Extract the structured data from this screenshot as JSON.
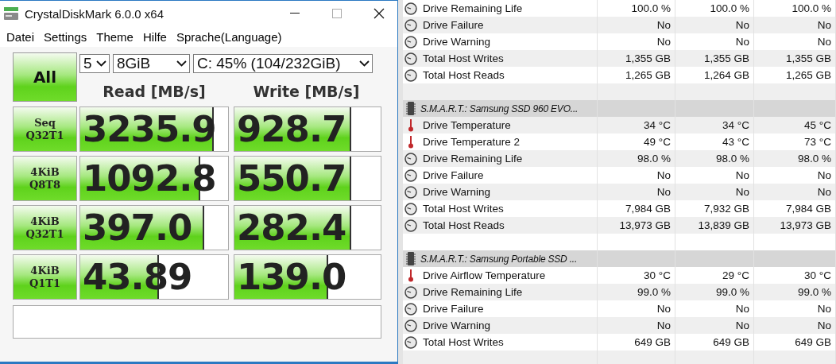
{
  "benchmark_window": {
    "title": "CrystalDiskMark 6.0.0 x64",
    "menu": [
      "Datei",
      "Settings",
      "Theme",
      "Hilfe",
      "Sprache(Language)"
    ],
    "all_button": "All",
    "count": "5",
    "size": "8GiB",
    "drive": "C: 45% (104/232GiB)",
    "read_header": "Read [MB/s]",
    "write_header": "Write [MB/s]",
    "tests": [
      {
        "label": "Seq",
        "sub": "Q32T1",
        "read": {
          "value": "3235.9",
          "level": 0.89
        },
        "write": {
          "value": "928.7",
          "level": 0.79
        }
      },
      {
        "label": "4KiB",
        "sub": "Q8T8",
        "read": {
          "value": "1092.8",
          "level": 0.8
        },
        "write": {
          "value": "550.7",
          "level": 0.79
        }
      },
      {
        "label": "4KiB",
        "sub": "Q32T1",
        "read": {
          "value": "397.0",
          "level": 0.83
        },
        "write": {
          "value": "282.4",
          "level": 0.79
        }
      },
      {
        "label": "4KiB",
        "sub": "Q1T1",
        "read": {
          "value": "43.89",
          "level": 0.52
        },
        "write": {
          "value": "139.0",
          "level": 0.63
        }
      }
    ]
  },
  "sensors": {
    "rows": [
      {
        "kind": "gauge",
        "label": "Drive Remaining Life",
        "values": [
          "100.0 %",
          "100.0 %",
          "100.0 %"
        ]
      },
      {
        "kind": "gauge",
        "label": "Drive Failure",
        "values": [
          "No",
          "No",
          "No"
        ]
      },
      {
        "kind": "gauge",
        "label": "Drive Warning",
        "values": [
          "No",
          "No",
          "No"
        ]
      },
      {
        "kind": "gauge",
        "label": "Total Host Writes",
        "values": [
          "1,355 GB",
          "1,355 GB",
          "1,355 GB"
        ]
      },
      {
        "kind": "gauge",
        "label": "Total Host Reads",
        "values": [
          "1,265 GB",
          "1,264 GB",
          "1,265 GB"
        ]
      },
      {
        "kind": "blank"
      },
      {
        "kind": "header",
        "label": "S.M.A.R.T.: Samsung SSD 960 EVO..."
      },
      {
        "kind": "temperature",
        "label": "Drive Temperature",
        "values": [
          "34 °C",
          "34 °C",
          "45 °C"
        ]
      },
      {
        "kind": "temperature",
        "label": "Drive Temperature 2",
        "values": [
          "49 °C",
          "43 °C",
          "73 °C"
        ]
      },
      {
        "kind": "gauge",
        "label": "Drive Remaining Life",
        "values": [
          "98.0 %",
          "98.0 %",
          "98.0 %"
        ]
      },
      {
        "kind": "gauge",
        "label": "Drive Failure",
        "values": [
          "No",
          "No",
          "No"
        ]
      },
      {
        "kind": "gauge",
        "label": "Drive Warning",
        "values": [
          "No",
          "No",
          "No"
        ]
      },
      {
        "kind": "gauge",
        "label": "Total Host Writes",
        "values": [
          "7,984 GB",
          "7,932 GB",
          "7,984 GB"
        ]
      },
      {
        "kind": "gauge",
        "label": "Total Host Reads",
        "values": [
          "13,973 GB",
          "13,839 GB",
          "13,973 GB"
        ]
      },
      {
        "kind": "blank"
      },
      {
        "kind": "header",
        "label": "S.M.A.R.T.: Samsung Portable SSD ..."
      },
      {
        "kind": "temperature",
        "label": "Drive Airflow Temperature",
        "values": [
          "30 °C",
          "29 °C",
          "30 °C"
        ]
      },
      {
        "kind": "gauge",
        "label": "Drive Remaining Life",
        "values": [
          "99.0 %",
          "99.0 %",
          "99.0 %"
        ]
      },
      {
        "kind": "gauge",
        "label": "Drive Failure",
        "values": [
          "No",
          "No",
          "No"
        ]
      },
      {
        "kind": "gauge",
        "label": "Drive Warning",
        "values": [
          "No",
          "No",
          "No"
        ]
      },
      {
        "kind": "gauge",
        "label": "Total Host Writes",
        "values": [
          "649 GB",
          "649 GB",
          "649 GB"
        ]
      },
      {
        "kind": "blank"
      }
    ]
  }
}
